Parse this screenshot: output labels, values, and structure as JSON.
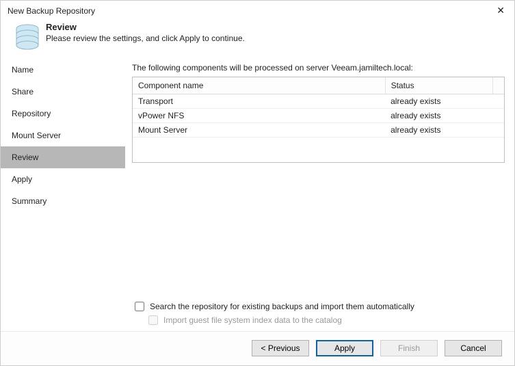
{
  "window": {
    "title": "New Backup Repository"
  },
  "header": {
    "heading": "Review",
    "subheading": "Please review the settings, and click Apply to continue."
  },
  "sidebar": {
    "items": [
      {
        "label": "Name"
      },
      {
        "label": "Share"
      },
      {
        "label": "Repository"
      },
      {
        "label": "Mount Server"
      },
      {
        "label": "Review"
      },
      {
        "label": "Apply"
      },
      {
        "label": "Summary"
      }
    ],
    "active_index": 4
  },
  "content": {
    "intro": "The following components will be processed on server Veeam.jamiltech.local:",
    "columns": {
      "name": "Component name",
      "status": "Status"
    },
    "rows": [
      {
        "name": "Transport",
        "status": "already exists"
      },
      {
        "name": "vPower NFS",
        "status": "already exists"
      },
      {
        "name": "Mount Server",
        "status": "already exists"
      }
    ],
    "checks": {
      "search_label": "Search the repository for existing backups and import them automatically",
      "import_label": "Import guest file system index data to the catalog"
    }
  },
  "footer": {
    "previous": "< Previous",
    "apply": "Apply",
    "finish": "Finish",
    "cancel": "Cancel"
  }
}
